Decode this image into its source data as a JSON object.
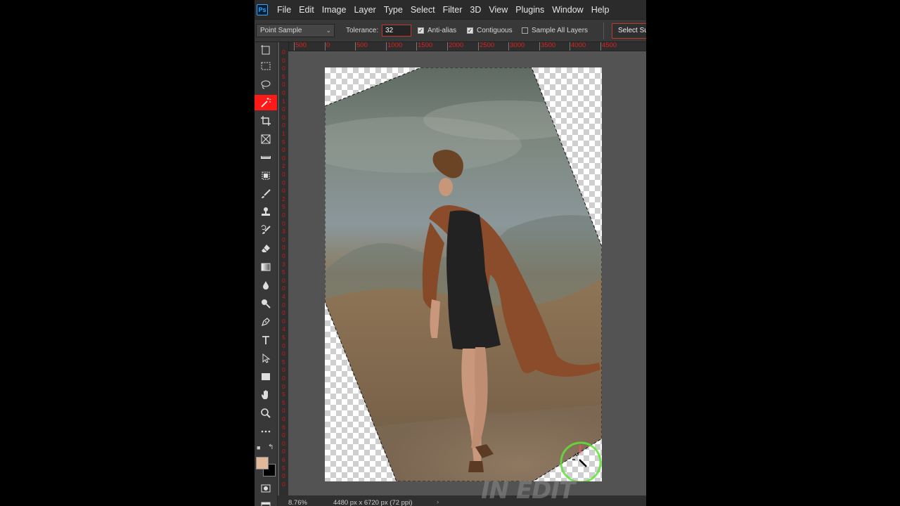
{
  "app": {
    "logo_text": "Ps"
  },
  "menu": [
    "File",
    "Edit",
    "Image",
    "Layer",
    "Type",
    "Select",
    "Filter",
    "3D",
    "View",
    "Plugins",
    "Window",
    "Help"
  ],
  "options_bar": {
    "sample_size": "Point Sample",
    "tolerance_label": "Tolerance:",
    "tolerance_value": "32",
    "anti_alias": {
      "label": "Anti-alias",
      "checked": true
    },
    "contiguous": {
      "label": "Contiguous",
      "checked": true
    },
    "sample_all_layers": {
      "label": "Sample All Layers",
      "checked": false
    },
    "select_subject_label": "Select Su"
  },
  "toolbar": {
    "tools": [
      "artboard-icon",
      "marquee-icon",
      "lasso-icon",
      "magic-wand-icon",
      "crop-icon",
      "frame-icon",
      "ruler-icon",
      "patch-icon",
      "brush-icon",
      "stamp-icon",
      "history-brush-icon",
      "eraser-icon",
      "gradient-icon",
      "blur-icon",
      "dodge-icon",
      "pen-icon",
      "type-icon",
      "path-select-icon",
      "rectangle-icon",
      "hand-icon",
      "zoom-icon",
      "more-icon"
    ],
    "active_tool": "magic-wand-icon",
    "foreground_color": "#e3b89a",
    "background_color": "#000000"
  },
  "ruler_top_labels": [
    "500",
    "0",
    "500",
    "1000",
    "1500",
    "2000",
    "2500",
    "3000",
    "3500",
    "4000",
    "4500"
  ],
  "ruler_left_digits": [
    "0",
    "0",
    "0",
    "5",
    "0",
    "0",
    "1",
    "0",
    "0",
    "0",
    "1",
    "5",
    "0",
    "0",
    "2",
    "0",
    "0",
    "0",
    "2",
    "5",
    "0",
    "0",
    "3",
    "0",
    "0",
    "0",
    "3",
    "5",
    "0",
    "0",
    "4",
    "0",
    "0",
    "0",
    "4",
    "5",
    "0",
    "0",
    "5",
    "0",
    "0",
    "0",
    "5",
    "5",
    "0",
    "0",
    "6",
    "0",
    "0",
    "0",
    "6",
    "5",
    "0",
    "0"
  ],
  "status": {
    "zoom": "8.76%",
    "doc_size": "4480 px x 6720 px (72 ppi)",
    "arrow": "›"
  },
  "watermark": "IN EDIT"
}
